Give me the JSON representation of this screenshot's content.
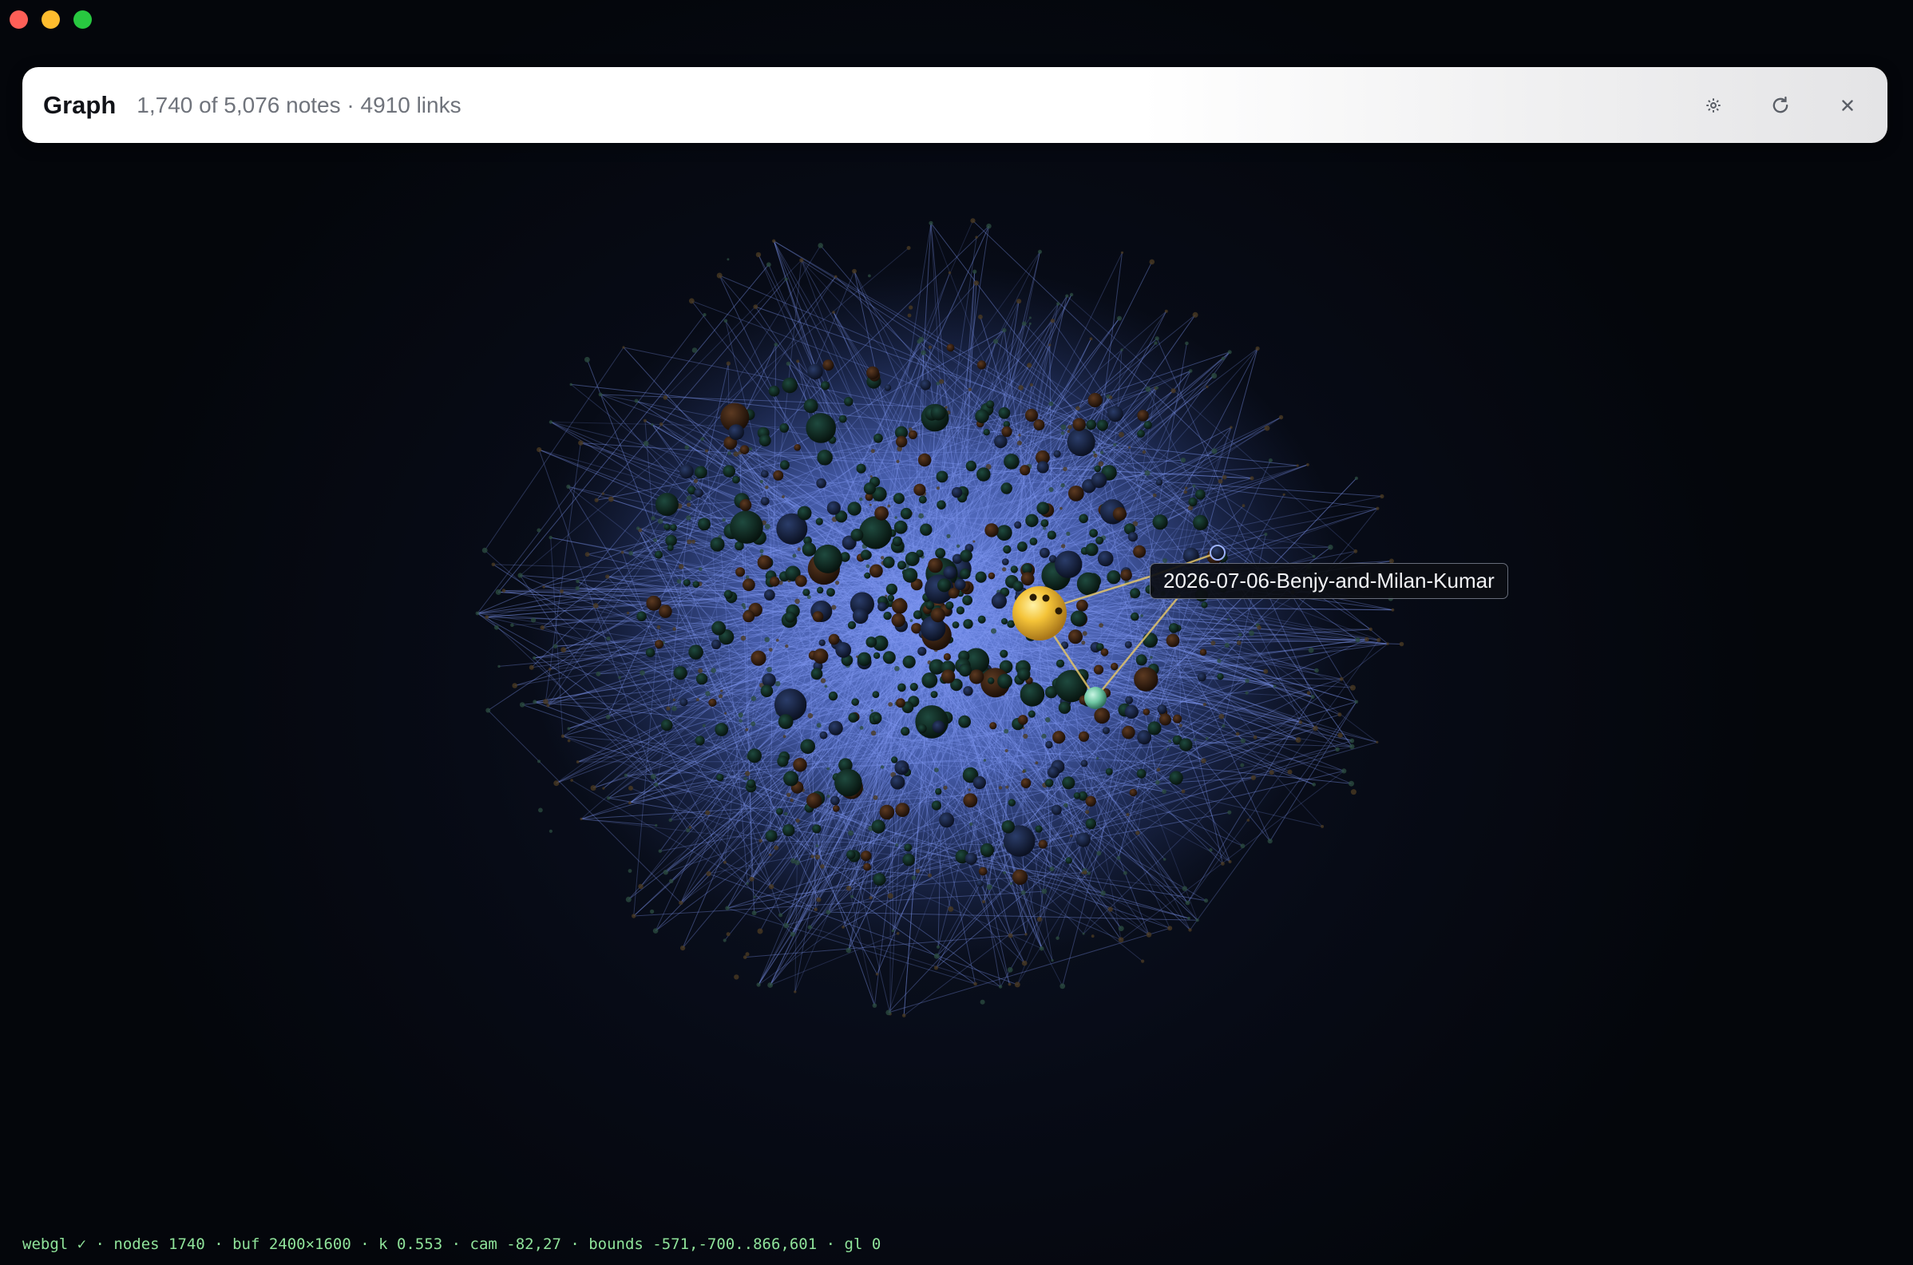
{
  "window": {
    "controls": [
      "close",
      "minimize",
      "zoom"
    ]
  },
  "header": {
    "title": "Graph",
    "stats": "1,740 of 5,076 notes · 4910 links",
    "actions": [
      {
        "name": "settings",
        "icon": "gear-icon"
      },
      {
        "name": "refresh",
        "icon": "refresh-icon"
      },
      {
        "name": "close",
        "icon": "close-icon"
      }
    ]
  },
  "graph": {
    "highlighted_node": "2026-07-06-Benjy-and-Milan-Kumar",
    "colors": {
      "background": "#04060b",
      "links": "#7e96f0",
      "highlight_node": "#f4c338",
      "neighbor_node": "#6fc7a4",
      "node_dark": "#0f2a24",
      "node_brown": "#3a2416"
    }
  },
  "debug_bar": {
    "text": "webgl ✓ · nodes 1740 · buf 2400×1600 · k 0.553 · cam -82,27 · bounds -571,-700..866,601 · gl 0"
  }
}
